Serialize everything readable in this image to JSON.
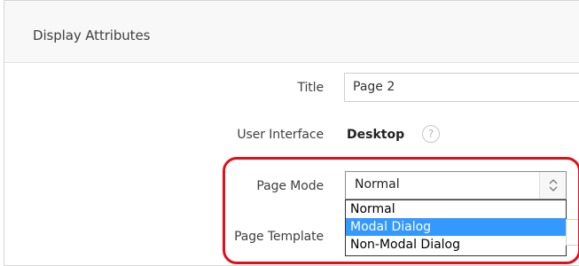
{
  "region": {
    "title": "Display Attributes"
  },
  "fields": {
    "title": {
      "label": "Title",
      "value": "Page 2"
    },
    "user_interface": {
      "label": "User Interface",
      "value": "Desktop",
      "help_icon": "?"
    },
    "page_mode": {
      "label": "Page Mode",
      "selected": "Normal",
      "options": [
        "Normal",
        "Modal Dialog",
        "Non-Modal Dialog"
      ],
      "highlighted_option": "Modal Dialog"
    },
    "page_template": {
      "label": "Page Template"
    }
  },
  "colors": {
    "highlight_ring": "#e0101a",
    "option_highlight": "#3399ff",
    "header_bg": "#f8f8f8"
  }
}
